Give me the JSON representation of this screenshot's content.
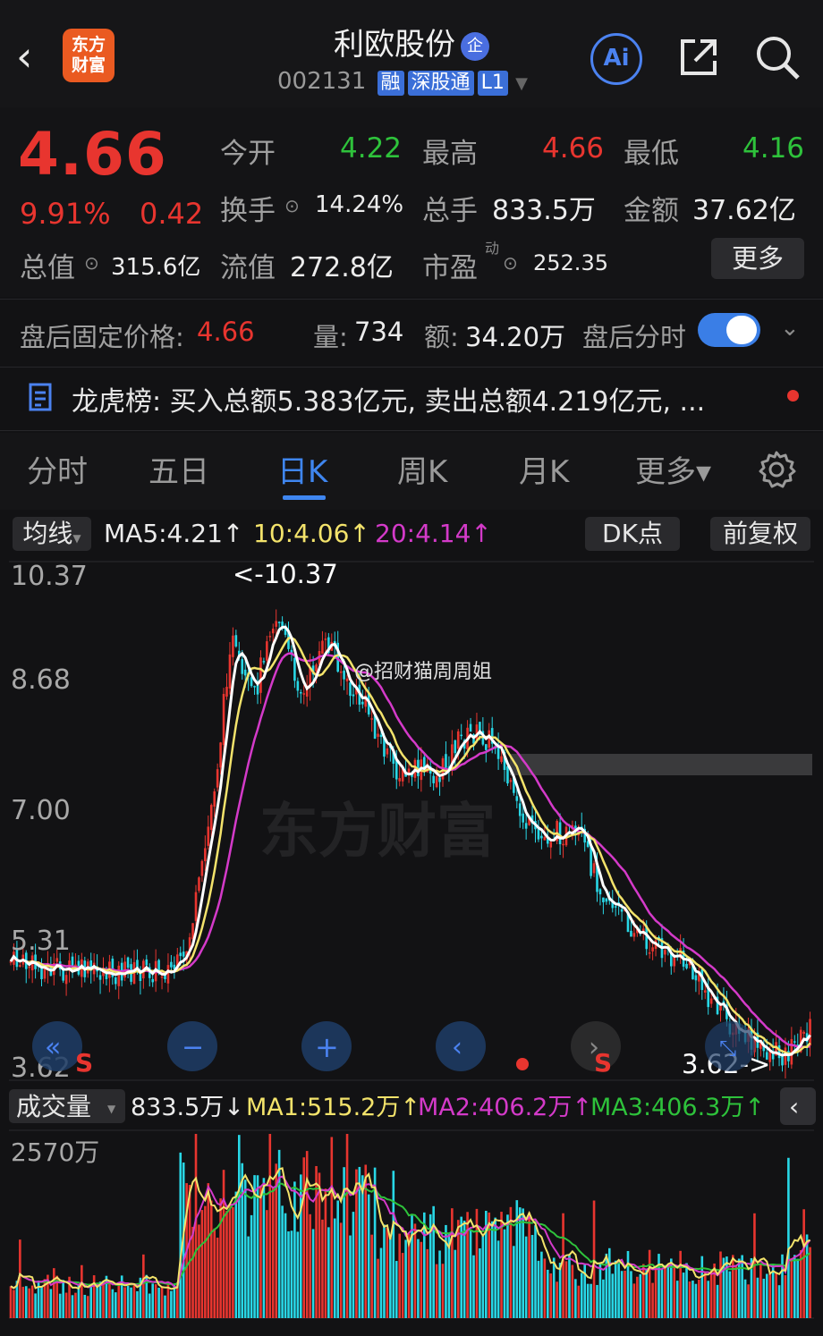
{
  "header": {
    "back_icon": "chevron-left-icon",
    "logo_line1": "东方",
    "logo_line2": "财富",
    "stock_name": "利欧股份",
    "badge": "企",
    "code": "002131",
    "tags": [
      "融",
      "深股通",
      "L1"
    ],
    "ai_label": "Ai",
    "share_icon": "share-icon",
    "search_icon": "search-icon"
  },
  "quote": {
    "price": "4.66",
    "change_pct": "9.91%",
    "change": "0.42",
    "open_label": "今开",
    "open": "4.22",
    "high_label": "最高",
    "high": "4.66",
    "low_label": "最低",
    "low": "4.16",
    "turnover_label": "换手",
    "turnover": "14.24%",
    "volume_label": "总手",
    "volume": "833.5万",
    "amount_label": "金额",
    "amount": "37.62亿",
    "mktcap_label": "总值",
    "mktcap": "315.6亿",
    "float_label": "流值",
    "float_cap": "272.8亿",
    "pe_label": "市盈",
    "pe_sup": "动",
    "pe": "252.35",
    "more": "更多"
  },
  "after_hours": {
    "fixed_price_label": "盘后固定价格:",
    "fixed_price": "4.66",
    "vol_label": "量:",
    "vol": "734",
    "amt_label": "额:",
    "amt": "34.20万",
    "timeshare_label": "盘后分时",
    "timeshare_on": true
  },
  "dragon_tiger": {
    "text": "龙虎榜:  买入总额5.383亿元, 卖出总额4.219亿元, ..."
  },
  "tabs": [
    "分时",
    "五日",
    "日K",
    "周K",
    "月K",
    "更多▾"
  ],
  "active_tab": "日K",
  "ma_bar": {
    "selector": "均线",
    "ma5": "MA5:4.21↑",
    "ma10": "10:4.06↑",
    "ma20": "20:4.14↑",
    "dk": "DK点",
    "adjust": "前复权"
  },
  "kline": {
    "y_labels": [
      "10.37",
      "8.68",
      "7.00",
      "5.31",
      "3.62"
    ],
    "max_annotation": "<-10.37",
    "min_annotation": "3.62->",
    "watermark": "东方财富",
    "user_watermark": "@招财猫周周姐",
    "signal": "S"
  },
  "volume_bar": {
    "selector": "成交量",
    "current": "833.5万↓",
    "ma1": "MA1:515.2万↑",
    "ma2": "MA2:406.2万↑",
    "ma3": "MA3:406.3万↑",
    "y_label": "2570万"
  },
  "colors": {
    "up": "#e8352f",
    "down": "#28d7e6",
    "accent": "#3f86f0",
    "ma5": "#ffffff",
    "ma10": "#f3e36b",
    "ma20": "#d43ac9",
    "ma3_vol": "#2ec23b"
  }
}
